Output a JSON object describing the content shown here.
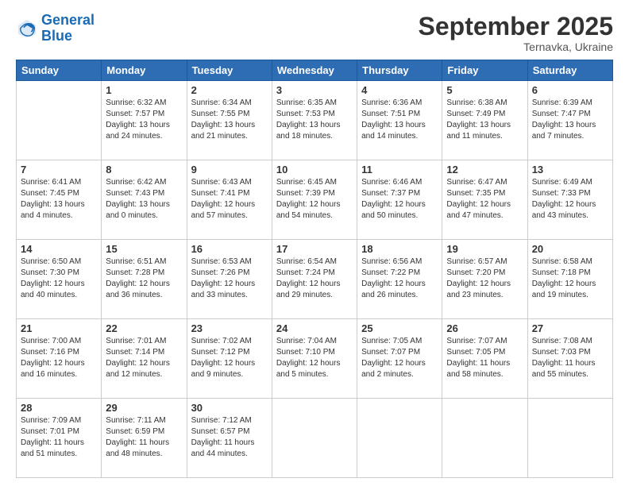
{
  "logo": {
    "line1": "General",
    "line2": "Blue"
  },
  "title": "September 2025",
  "subtitle": "Ternavka, Ukraine",
  "headers": [
    "Sunday",
    "Monday",
    "Tuesday",
    "Wednesday",
    "Thursday",
    "Friday",
    "Saturday"
  ],
  "weeks": [
    [
      {
        "day": "",
        "info": ""
      },
      {
        "day": "1",
        "info": "Sunrise: 6:32 AM\nSunset: 7:57 PM\nDaylight: 13 hours\nand 24 minutes."
      },
      {
        "day": "2",
        "info": "Sunrise: 6:34 AM\nSunset: 7:55 PM\nDaylight: 13 hours\nand 21 minutes."
      },
      {
        "day": "3",
        "info": "Sunrise: 6:35 AM\nSunset: 7:53 PM\nDaylight: 13 hours\nand 18 minutes."
      },
      {
        "day": "4",
        "info": "Sunrise: 6:36 AM\nSunset: 7:51 PM\nDaylight: 13 hours\nand 14 minutes."
      },
      {
        "day": "5",
        "info": "Sunrise: 6:38 AM\nSunset: 7:49 PM\nDaylight: 13 hours\nand 11 minutes."
      },
      {
        "day": "6",
        "info": "Sunrise: 6:39 AM\nSunset: 7:47 PM\nDaylight: 13 hours\nand 7 minutes."
      }
    ],
    [
      {
        "day": "7",
        "info": "Sunrise: 6:41 AM\nSunset: 7:45 PM\nDaylight: 13 hours\nand 4 minutes."
      },
      {
        "day": "8",
        "info": "Sunrise: 6:42 AM\nSunset: 7:43 PM\nDaylight: 13 hours\nand 0 minutes."
      },
      {
        "day": "9",
        "info": "Sunrise: 6:43 AM\nSunset: 7:41 PM\nDaylight: 12 hours\nand 57 minutes."
      },
      {
        "day": "10",
        "info": "Sunrise: 6:45 AM\nSunset: 7:39 PM\nDaylight: 12 hours\nand 54 minutes."
      },
      {
        "day": "11",
        "info": "Sunrise: 6:46 AM\nSunset: 7:37 PM\nDaylight: 12 hours\nand 50 minutes."
      },
      {
        "day": "12",
        "info": "Sunrise: 6:47 AM\nSunset: 7:35 PM\nDaylight: 12 hours\nand 47 minutes."
      },
      {
        "day": "13",
        "info": "Sunrise: 6:49 AM\nSunset: 7:33 PM\nDaylight: 12 hours\nand 43 minutes."
      }
    ],
    [
      {
        "day": "14",
        "info": "Sunrise: 6:50 AM\nSunset: 7:30 PM\nDaylight: 12 hours\nand 40 minutes."
      },
      {
        "day": "15",
        "info": "Sunrise: 6:51 AM\nSunset: 7:28 PM\nDaylight: 12 hours\nand 36 minutes."
      },
      {
        "day": "16",
        "info": "Sunrise: 6:53 AM\nSunset: 7:26 PM\nDaylight: 12 hours\nand 33 minutes."
      },
      {
        "day": "17",
        "info": "Sunrise: 6:54 AM\nSunset: 7:24 PM\nDaylight: 12 hours\nand 29 minutes."
      },
      {
        "day": "18",
        "info": "Sunrise: 6:56 AM\nSunset: 7:22 PM\nDaylight: 12 hours\nand 26 minutes."
      },
      {
        "day": "19",
        "info": "Sunrise: 6:57 AM\nSunset: 7:20 PM\nDaylight: 12 hours\nand 23 minutes."
      },
      {
        "day": "20",
        "info": "Sunrise: 6:58 AM\nSunset: 7:18 PM\nDaylight: 12 hours\nand 19 minutes."
      }
    ],
    [
      {
        "day": "21",
        "info": "Sunrise: 7:00 AM\nSunset: 7:16 PM\nDaylight: 12 hours\nand 16 minutes."
      },
      {
        "day": "22",
        "info": "Sunrise: 7:01 AM\nSunset: 7:14 PM\nDaylight: 12 hours\nand 12 minutes."
      },
      {
        "day": "23",
        "info": "Sunrise: 7:02 AM\nSunset: 7:12 PM\nDaylight: 12 hours\nand 9 minutes."
      },
      {
        "day": "24",
        "info": "Sunrise: 7:04 AM\nSunset: 7:10 PM\nDaylight: 12 hours\nand 5 minutes."
      },
      {
        "day": "25",
        "info": "Sunrise: 7:05 AM\nSunset: 7:07 PM\nDaylight: 12 hours\nand 2 minutes."
      },
      {
        "day": "26",
        "info": "Sunrise: 7:07 AM\nSunset: 7:05 PM\nDaylight: 11 hours\nand 58 minutes."
      },
      {
        "day": "27",
        "info": "Sunrise: 7:08 AM\nSunset: 7:03 PM\nDaylight: 11 hours\nand 55 minutes."
      }
    ],
    [
      {
        "day": "28",
        "info": "Sunrise: 7:09 AM\nSunset: 7:01 PM\nDaylight: 11 hours\nand 51 minutes."
      },
      {
        "day": "29",
        "info": "Sunrise: 7:11 AM\nSunset: 6:59 PM\nDaylight: 11 hours\nand 48 minutes."
      },
      {
        "day": "30",
        "info": "Sunrise: 7:12 AM\nSunset: 6:57 PM\nDaylight: 11 hours\nand 44 minutes."
      },
      {
        "day": "",
        "info": ""
      },
      {
        "day": "",
        "info": ""
      },
      {
        "day": "",
        "info": ""
      },
      {
        "day": "",
        "info": ""
      }
    ]
  ]
}
